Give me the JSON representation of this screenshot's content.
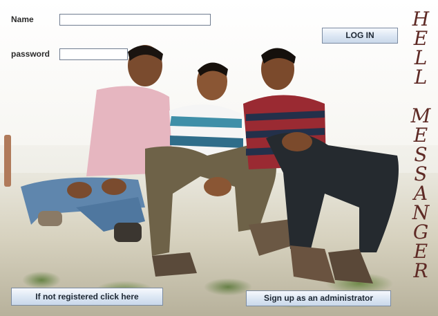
{
  "form": {
    "name_label": "Name",
    "password_label": "password",
    "name_value": "",
    "password_value": "",
    "login_button": "LOG IN",
    "register_button": "If not registered click here",
    "admin_button": "Sign up as an administrator"
  },
  "brand": {
    "title_line1": [
      "H",
      "E",
      "L",
      "L"
    ],
    "title_line2": [
      "M",
      "E",
      "S",
      "S",
      "A",
      "N",
      "G",
      "E",
      "R"
    ]
  },
  "colors": {
    "button_border": "#7a8aa0",
    "title_color": "#5e2a25"
  }
}
